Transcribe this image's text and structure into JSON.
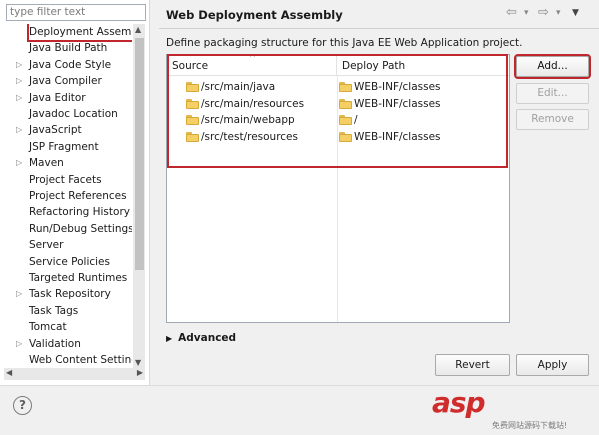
{
  "filter": {
    "placeholder": "type filter text"
  },
  "tree": [
    {
      "label": "Deployment Assembly",
      "expandable": false,
      "selected": true
    },
    {
      "label": "Java Build Path",
      "expandable": false
    },
    {
      "label": "Java Code Style",
      "expandable": true
    },
    {
      "label": "Java Compiler",
      "expandable": true
    },
    {
      "label": "Java Editor",
      "expandable": true
    },
    {
      "label": "Javadoc Location",
      "expandable": false
    },
    {
      "label": "JavaScript",
      "expandable": true
    },
    {
      "label": "JSP Fragment",
      "expandable": false
    },
    {
      "label": "Maven",
      "expandable": true
    },
    {
      "label": "Project Facets",
      "expandable": false
    },
    {
      "label": "Project References",
      "expandable": false
    },
    {
      "label": "Refactoring History",
      "expandable": false
    },
    {
      "label": "Run/Debug Settings",
      "expandable": false
    },
    {
      "label": "Server",
      "expandable": false
    },
    {
      "label": "Service Policies",
      "expandable": false
    },
    {
      "label": "Targeted Runtimes",
      "expandable": false
    },
    {
      "label": "Task Repository",
      "expandable": true
    },
    {
      "label": "Task Tags",
      "expandable": false
    },
    {
      "label": "Tomcat",
      "expandable": false
    },
    {
      "label": "Validation",
      "expandable": true
    },
    {
      "label": "Web Content Settings",
      "expandable": false
    }
  ],
  "page": {
    "title": "Web Deployment Assembly",
    "description": "Define packaging structure for this Java EE Web Application project."
  },
  "table": {
    "headers": {
      "source": "Source",
      "deploy": "Deploy Path"
    },
    "rows": [
      {
        "source": "/src/main/java",
        "deploy": "WEB-INF/classes"
      },
      {
        "source": "/src/main/resources",
        "deploy": "WEB-INF/classes"
      },
      {
        "source": "/src/main/webapp",
        "deploy": "/"
      },
      {
        "source": "/src/test/resources",
        "deploy": "WEB-INF/classes"
      }
    ]
  },
  "buttons": {
    "add": "Add...",
    "edit": "Edit...",
    "remove": "Remove",
    "revert": "Revert",
    "apply": "Apply"
  },
  "advanced": {
    "label": "Advanced"
  },
  "help": {
    "symbol": "?"
  },
  "watermark": {
    "logo": "asp",
    "tagline": "免费网站源码下载站!"
  },
  "colors": {
    "highlight_red": "#c0272d"
  }
}
